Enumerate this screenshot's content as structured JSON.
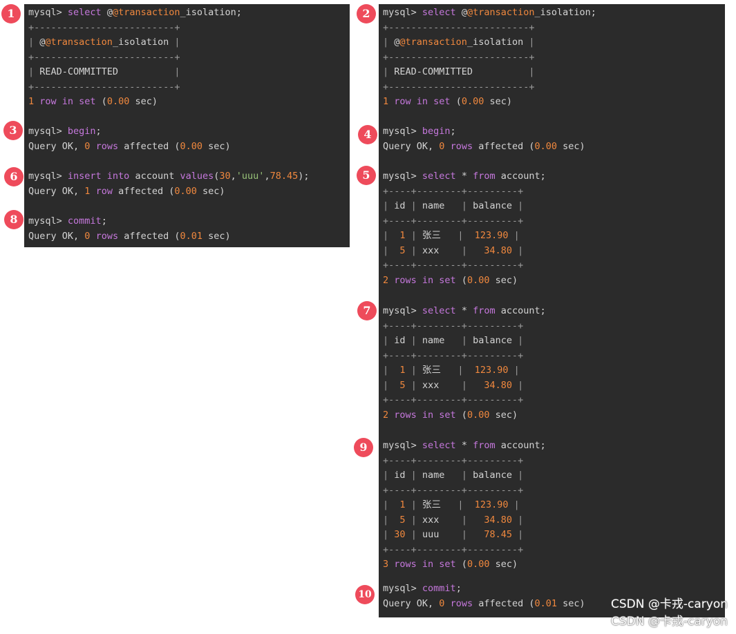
{
  "left_terminal": {
    "lines": [
      {
        "t": "mysql> ",
        "c": "prompt"
      },
      {
        "t": "+-------------------------+",
        "c": "border"
      },
      {
        "t": "| @@transaction_isolation |",
        "c": "border"
      },
      {
        "t": "+-------------------------+",
        "c": "border"
      },
      {
        "t": "| READ-COMMITTED          |",
        "c": "border"
      },
      {
        "t": "+-------------------------+",
        "c": "border"
      },
      {
        "t": "1 row in set (0.00 sec)",
        "c": "num"
      },
      {
        "t": "",
        "c": ""
      },
      {
        "t": "mysql> begin;",
        "c": "prompt"
      },
      {
        "t": "Query OK, 0 rows affected (0.00 sec)",
        "c": "prompt"
      },
      {
        "t": "",
        "c": ""
      },
      {
        "t": "mysql> insert into account values(30,'uuu',78.45);",
        "c": "prompt"
      },
      {
        "t": "Query OK, 1 row affected (0.00 sec)",
        "c": "prompt"
      },
      {
        "t": "",
        "c": ""
      },
      {
        "t": "mysql> commit;",
        "c": "prompt"
      },
      {
        "t": "Query OK, 0 rows affected (0.01 sec)",
        "c": "prompt"
      }
    ]
  },
  "right_terminal": {
    "sql_select_isolation": "mysql> select @@transaction_isolation;",
    "isolation_value": "READ-COMMITTED",
    "row_count_1": "1 row in set (0.00 sec)",
    "begin": "mysql> begin;",
    "ok_begin": "Query OK, 0 rows affected (0.00 sec)",
    "select_account": "mysql> select * from account;",
    "rows_2": "2 rows in set (0.00 sec)",
    "rows_3": "3 rows in set (0.00 sec)",
    "commit": "mysql> commit;",
    "ok_commit": "Query OK, 0 rows affected (0.01 sec)"
  },
  "badges": [
    "1",
    "2",
    "3",
    "4",
    "5",
    "6",
    "7",
    "8",
    "9",
    "10"
  ],
  "watermark": [
    "CSDN @卡戎-caryon",
    "CSDN @卡戎-caryon"
  ]
}
